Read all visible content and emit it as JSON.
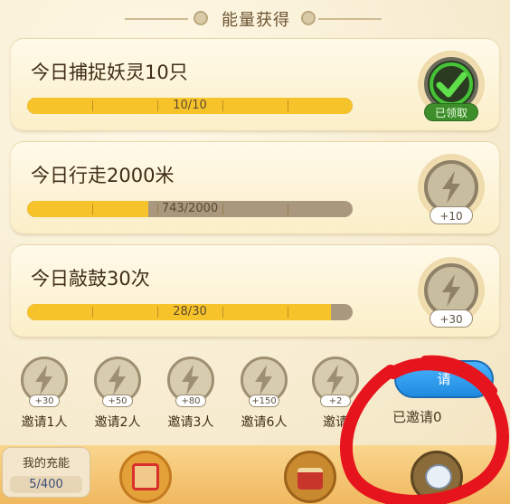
{
  "header": {
    "title": "能量获得"
  },
  "tasks": [
    {
      "title": "今日捕捉妖灵10只",
      "progress_text": "10/10",
      "progress": 1.0,
      "reward_label": "已领取",
      "state": "claimed"
    },
    {
      "title": "今日行走2000米",
      "progress_text": "743/2000",
      "progress": 0.3715,
      "reward_label": "+10",
      "state": "locked"
    },
    {
      "title": "今日敲鼓30次",
      "progress_text": "28/30",
      "progress": 0.9333,
      "reward_label": "+30",
      "state": "locked"
    }
  ],
  "invites": [
    {
      "label": "邀请1人",
      "reward": "+30"
    },
    {
      "label": "邀请2人",
      "reward": "+50"
    },
    {
      "label": "邀请3人",
      "reward": "+80"
    },
    {
      "label": "邀请6人",
      "reward": "+150"
    },
    {
      "label": "邀请",
      "reward": "+2"
    }
  ],
  "invite_button": {
    "label": "请"
  },
  "invited_status": "已邀请0",
  "energy_box": {
    "title": "我的充能",
    "value": "5/400"
  },
  "colors": {
    "accent": "#f6c32a",
    "track": "#a9987d",
    "invite_blue": "#1e8ae0",
    "annotation_red": "#e6141c"
  }
}
